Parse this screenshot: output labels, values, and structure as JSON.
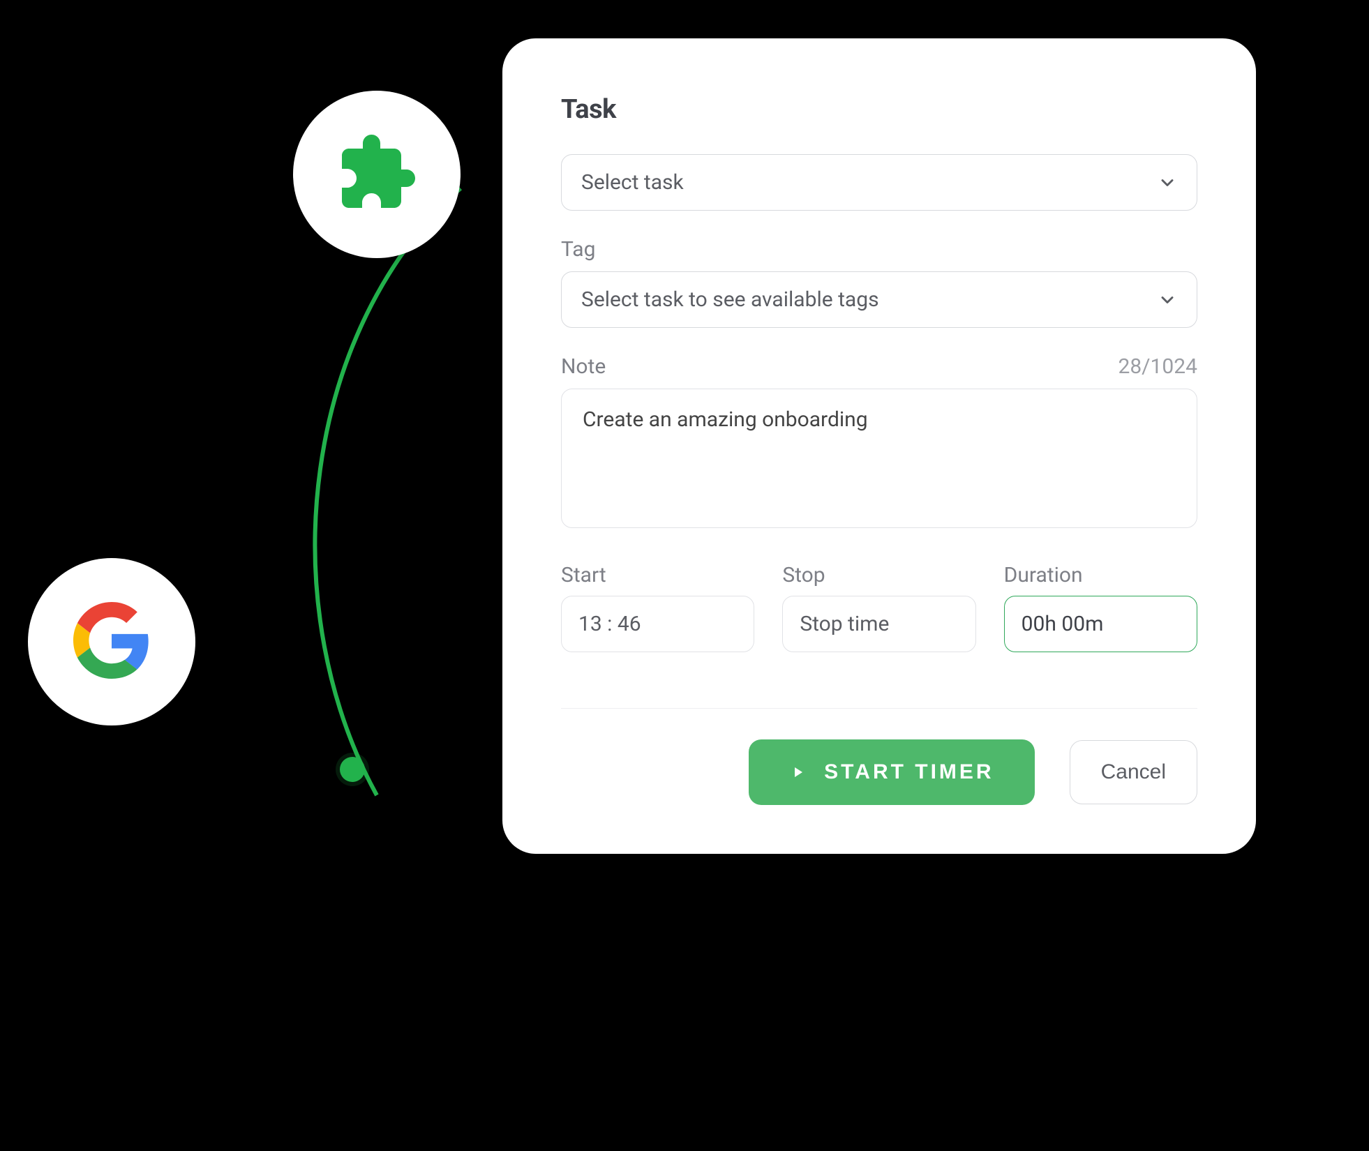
{
  "panel": {
    "title": "Task",
    "task_select": {
      "placeholder": "Select task"
    },
    "tag": {
      "label": "Tag",
      "placeholder": "Select task to see available tags"
    },
    "note": {
      "label": "Note",
      "counter": "28/1024",
      "value": "Create an amazing onboarding"
    },
    "start": {
      "label": "Start",
      "value": "13  :  46"
    },
    "stop": {
      "label": "Stop",
      "value": "Stop time"
    },
    "duration": {
      "label": "Duration",
      "value": "00h 00m"
    },
    "actions": {
      "primary": "START TIMER",
      "secondary": "Cancel"
    }
  },
  "accent_color": "#22b24c"
}
